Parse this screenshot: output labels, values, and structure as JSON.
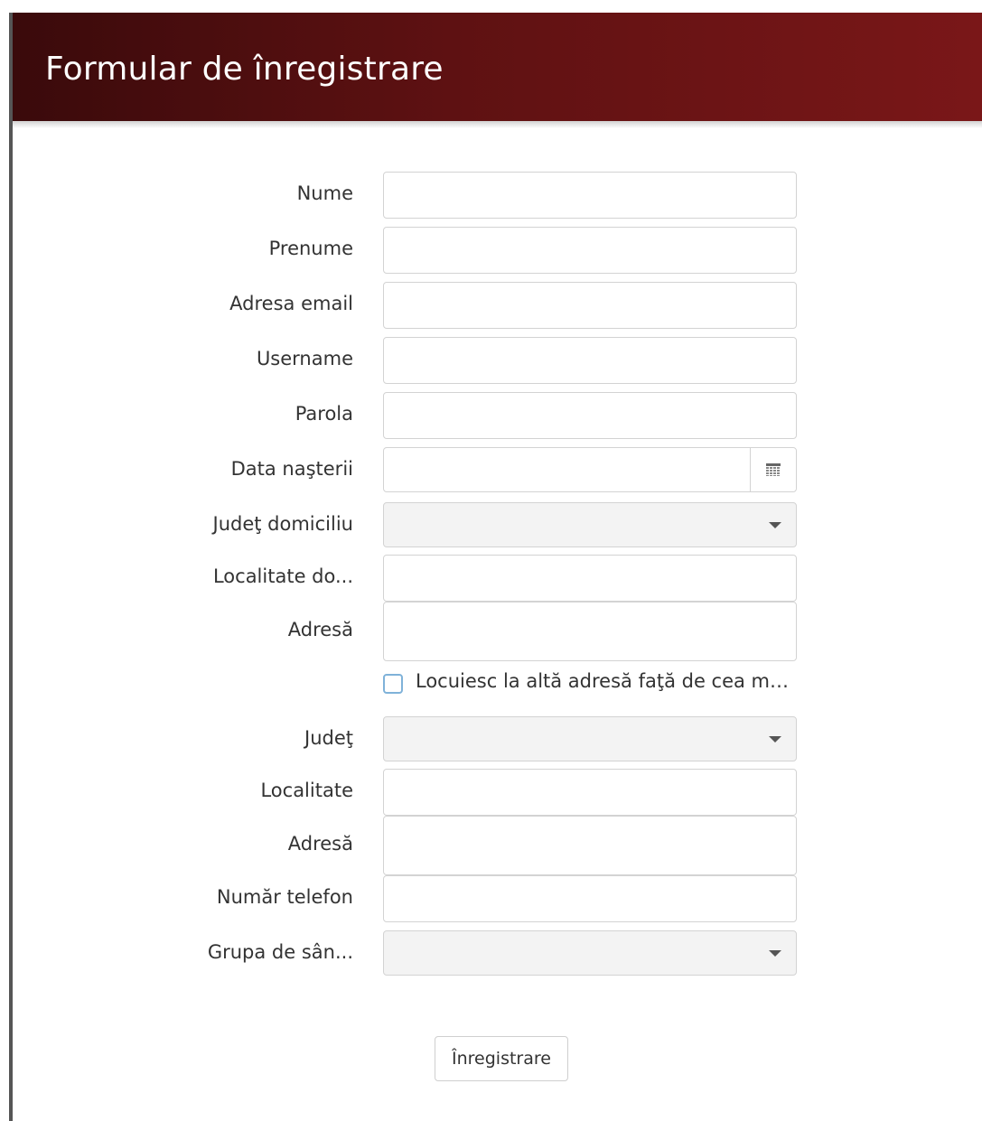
{
  "header": {
    "title": "Formular de înregistrare",
    "gradient_start": "#3a0a0b",
    "gradient_end": "#7a1718"
  },
  "form": {
    "fields": {
      "nume": {
        "label": "Nume",
        "value": ""
      },
      "prenume": {
        "label": "Prenume",
        "value": ""
      },
      "email": {
        "label": "Adresa email",
        "value": ""
      },
      "username": {
        "label": "Username",
        "value": ""
      },
      "parola": {
        "label": "Parola",
        "value": ""
      },
      "data_nasterii": {
        "label": "Data naşterii",
        "value": "",
        "icon": "calendar-icon"
      },
      "judet_domiciliu": {
        "label": "Judeţ domiciliu",
        "selected": "",
        "icon": "chevron-down-icon"
      },
      "localitate_domiciliu": {
        "label": "Localitate do...",
        "value": ""
      },
      "adresa_domiciliu": {
        "label": "Adresă",
        "value": ""
      },
      "judet": {
        "label": "Judeţ",
        "selected": "",
        "icon": "chevron-down-icon"
      },
      "localitate": {
        "label": "Localitate",
        "value": ""
      },
      "adresa": {
        "label": "Adresă",
        "value": ""
      },
      "telefon": {
        "label": "Număr telefon",
        "value": ""
      },
      "grupa_sange": {
        "label": "Grupa de sân...",
        "selected": "",
        "icon": "chevron-down-icon"
      }
    },
    "checkbox": {
      "label": "Locuiesc la altă adresă faţă de cea me...",
      "checked": false,
      "border_color": "#7fb2d9"
    },
    "submit_label": "Înregistrare"
  }
}
